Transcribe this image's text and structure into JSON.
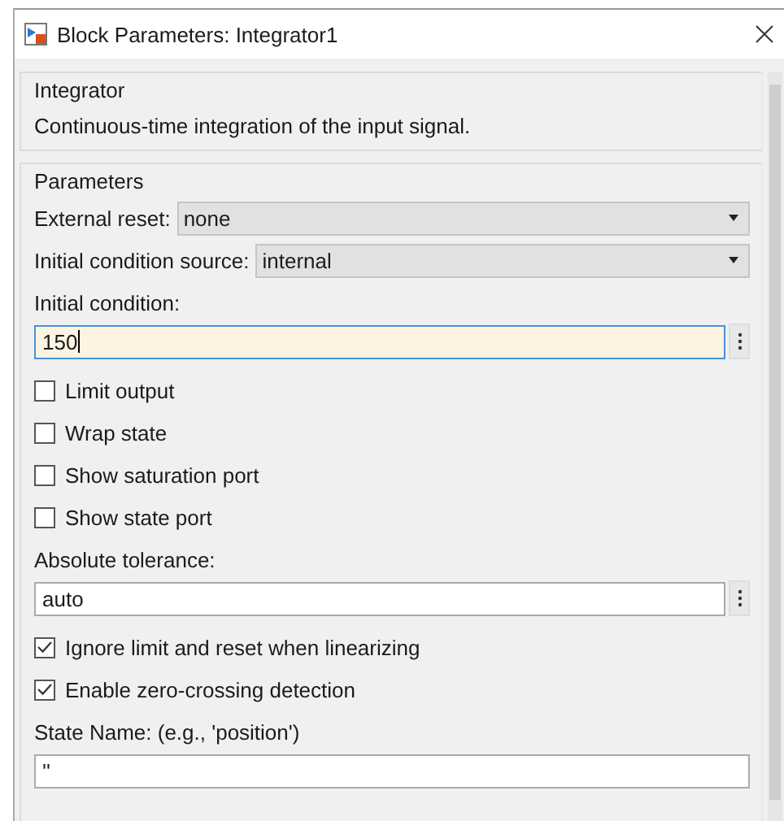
{
  "window": {
    "title": "Block Parameters: Integrator1"
  },
  "description": {
    "heading": "Integrator",
    "text": "Continuous-time integration of the input signal."
  },
  "parameters": {
    "heading": "Parameters",
    "items": [
      {
        "kind": "dropdown",
        "label": "External reset:",
        "value": "none"
      },
      {
        "kind": "dropdown",
        "label": "Initial condition source:",
        "value": "internal"
      },
      {
        "kind": "label",
        "text": "Initial condition:"
      },
      {
        "kind": "field",
        "value": "150",
        "focused": true,
        "menu": true
      },
      {
        "kind": "checkbox",
        "label": "Limit output",
        "checked": false
      },
      {
        "kind": "checkbox",
        "label": "Wrap state",
        "checked": false
      },
      {
        "kind": "checkbox",
        "label": "Show saturation port",
        "checked": false
      },
      {
        "kind": "checkbox",
        "label": "Show state port",
        "checked": false
      },
      {
        "kind": "label",
        "text": "Absolute tolerance:"
      },
      {
        "kind": "field",
        "value": "auto",
        "focused": false,
        "menu": true
      },
      {
        "kind": "checkbox",
        "label": "Ignore limit and reset when linearizing",
        "checked": true
      },
      {
        "kind": "checkbox",
        "label": "Enable zero-crossing detection",
        "checked": true
      },
      {
        "kind": "label",
        "text": "State Name: (e.g., 'position')"
      },
      {
        "kind": "field",
        "value": "''",
        "focused": false,
        "menu": false
      }
    ]
  }
}
